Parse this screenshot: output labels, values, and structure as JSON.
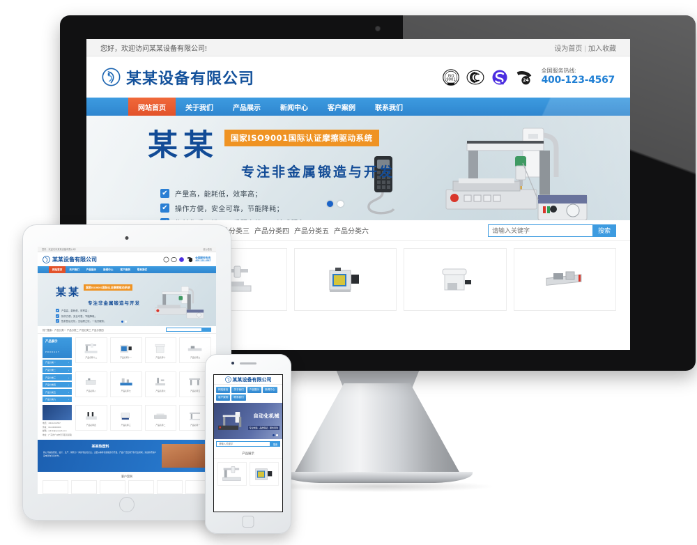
{
  "site": {
    "topbar": {
      "welcome": "您好，欢迎访问某某设备有限公司!",
      "set_home": "设为首页",
      "separator": "|",
      "add_favorite": "加入收藏"
    },
    "header": {
      "logo_text": "某某设备有限公司",
      "logo_icon": "circle-swirl-logo-icon",
      "certifications": [
        "iso-9001-badge-icon",
        "ccc-certification-icon",
        "s-quality-mark-icon",
        "24-hours-phone-icon"
      ],
      "hotline_label": "全国服务热线:",
      "hotline_number": "400-123-4567"
    },
    "nav": {
      "items": [
        {
          "label": "网站首页",
          "active": true
        },
        {
          "label": "关于我们",
          "active": false
        },
        {
          "label": "产品展示",
          "active": false
        },
        {
          "label": "新闻中心",
          "active": false
        },
        {
          "label": "客户案例",
          "active": false
        },
        {
          "label": "联系我们",
          "active": false
        }
      ]
    },
    "banner": {
      "title": "某某",
      "badge": "国家ISO9001国际认证摩擦驱动系统",
      "subtitle": "专注非金属锻造与开发",
      "bullets": [
        "产量高，能耗低，效率高；",
        "操作方便，安全可靠，节能降耗；",
        "售前售后无忧，无后顾之忧，一站式服务；"
      ],
      "dots": [
        {
          "active": true
        },
        {
          "active": false
        }
      ],
      "machine_image": "dispensing-robot-machine-photo",
      "handheld_image": "handheld-controller-photo"
    },
    "search_row": {
      "hot_label": "热门搜索：",
      "categories": [
        "产品分类一",
        "产品分类二",
        "产品分类三",
        "产品分类四",
        "产品分类五",
        "产品分类六"
      ],
      "search_placeholder": "请输入关键字",
      "search_button": "搜索"
    },
    "products": {
      "sidebar_title": "产品展示",
      "sidebar_subtitle": "PRODUCT",
      "sidebar_items": [
        "产品分类一",
        "产品分类二",
        "产品分类三",
        "产品分类四",
        "产品分类五",
        "产品分类六"
      ],
      "cards": [
        {
          "caption": "产品名称十二",
          "image": "gantry-dispensing-machine-photo"
        },
        {
          "caption": "产品名称十一",
          "image": "blue-enclosure-machine-photo"
        },
        {
          "caption": "产品名称十",
          "image": "white-cabinet-machine-photo"
        },
        {
          "caption": "产品名称九",
          "image": "conveyor-line-machine-photo"
        },
        {
          "caption": "产品名称八",
          "image": "bench-unit-machine-photo"
        },
        {
          "caption": "产品名称七",
          "image": "desktop-robot-machine-photo"
        },
        {
          "caption": "产品名称六",
          "image": "arm-dispenser-machine-photo"
        },
        {
          "caption": "产品名称五",
          "image": "gantry-axis-machine-photo"
        },
        {
          "caption": "产品名称四",
          "image": "dual-head-machine-photo"
        },
        {
          "caption": "产品名称三",
          "image": "inline-printer-machine-photo"
        },
        {
          "caption": "产品名称二",
          "image": "platform-table-machine-photo"
        },
        {
          "caption": "产品名称一",
          "image": "small-robot-machine-photo"
        }
      ]
    },
    "contact_box": {
      "image": "customer-service-photo",
      "lines": [
        "电话：400-123-4567",
        "传真：010-00000000",
        "邮箱：admin@youweb.com",
        "地址：广东省广州市天河区某某路"
      ]
    },
    "about": {
      "title": "某某热塑料",
      "paragraph": "我公司是集研发、设计、生产、销售为一体的专业化企业，主要从事非金属锻造与开发，产品广泛应用于各行业领域，欢迎新老客户来电咨询洽谈合作。",
      "image": "factory-building-photo"
    },
    "strip": {
      "title": "客户案例",
      "items": [
        "case-thumb-1",
        "case-thumb-2",
        "case-thumb-3",
        "case-thumb-4",
        "case-thumb-5",
        "case-thumb-6"
      ]
    }
  },
  "mobile": {
    "logo_text": "某某设备有限公司",
    "nav": [
      "网站首页",
      "关于我们",
      "产品展示",
      "新闻中心",
      "客户案例",
      "联系我们"
    ],
    "banner_title": "自动化机械",
    "banner_sub": "专业制造 · 品质保证 · 服务周到",
    "search_placeholder": "请输入关键字",
    "search_button": "搜索",
    "section_title": "产品展示",
    "cards": [
      "mobile-product-1",
      "mobile-product-2"
    ],
    "dots": [
      {
        "active": true
      },
      {
        "active": false
      }
    ]
  },
  "devices": {
    "monitor": "desktop-monitor-mockup",
    "tablet": "tablet-mockup",
    "phone": "smartphone-mockup"
  },
  "theme": {
    "primary_blue": "#2f86cf",
    "nav_blue": "#3d9be0",
    "accent_orange": "#e2522a",
    "badge_orange": "#ef9323",
    "logo_blue": "#13519b",
    "title_blue": "#124b96",
    "phone_blue": "#1f7fd4"
  }
}
